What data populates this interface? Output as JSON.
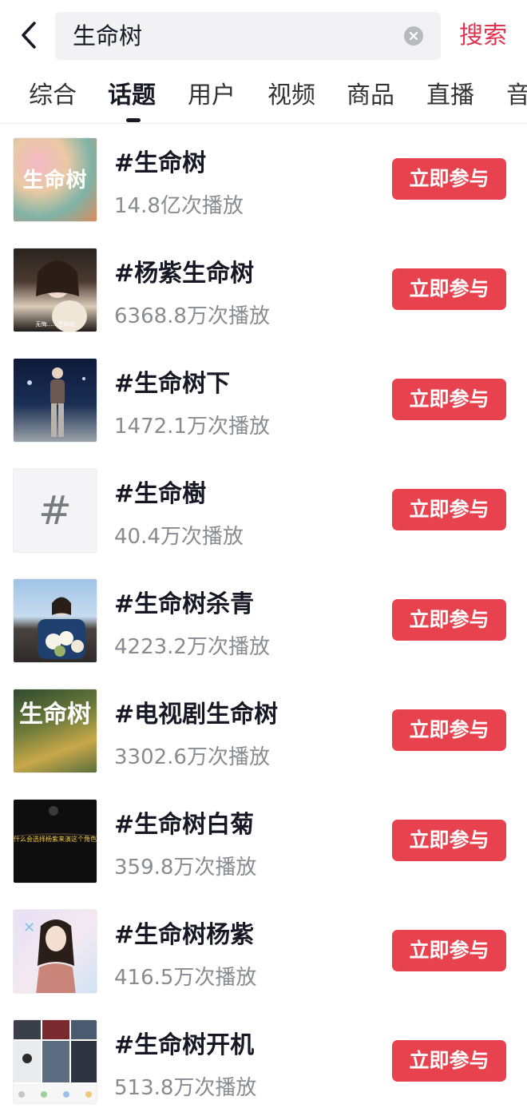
{
  "search": {
    "query": "生命树",
    "submit_label": "搜索"
  },
  "tabs": [
    {
      "label": "综合",
      "active": false
    },
    {
      "label": "话题",
      "active": true
    },
    {
      "label": "用户",
      "active": false
    },
    {
      "label": "视频",
      "active": false
    },
    {
      "label": "商品",
      "active": false
    },
    {
      "label": "直播",
      "active": false
    },
    {
      "label": "音",
      "active": false
    }
  ],
  "topics": [
    {
      "title": "#生命树",
      "plays": "14.8亿次播放",
      "button": "立即参与",
      "thumb_text": "生命树"
    },
    {
      "title": "#杨紫生命树",
      "plays": "6368.8万次播放",
      "button": "立即参与",
      "thumb_text": "无悔……生命树"
    },
    {
      "title": "#生命树下",
      "plays": "1472.1万次播放",
      "button": "立即参与"
    },
    {
      "title": "#生命樹",
      "plays": "40.4万次播放",
      "button": "立即参与",
      "thumb_text": "#"
    },
    {
      "title": "#生命树杀青",
      "plays": "4223.2万次播放",
      "button": "立即参与"
    },
    {
      "title": "#电视剧生命树",
      "plays": "3302.6万次播放",
      "button": "立即参与",
      "thumb_text": "生命树"
    },
    {
      "title": "#生命树白菊",
      "plays": "359.8万次播放",
      "button": "立即参与",
      "thumb_text": "什么会选择杨紫来演这个角色"
    },
    {
      "title": "#生命树杨紫",
      "plays": "416.5万次播放",
      "button": "立即参与"
    },
    {
      "title": "#生命树开机",
      "plays": "513.8万次播放",
      "button": "立即参与"
    }
  ],
  "colors": {
    "accent": "#e9424f",
    "search_label": "#e0334f",
    "secondary_text": "#8a8b91",
    "search_bg": "#f2f2f4"
  },
  "icons": {
    "back": "chevron-left-icon",
    "clear": "clear-circle-icon"
  }
}
